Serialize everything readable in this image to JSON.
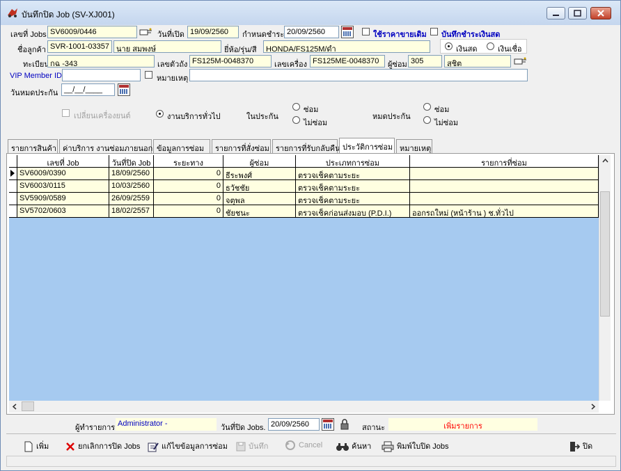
{
  "window": {
    "title": "บันทึกปิด Job (SV-XJ001)"
  },
  "header": {
    "job_no_label": "เลขที่ Jobs",
    "job_no": "SV6009/0446",
    "open_date_label": "วันที่เปิด",
    "open_date": "19/09/2560",
    "due_label": "กำหนดชำระ",
    "due_date": "20/09/2560",
    "use_old_price_label": "ใช้ราคาขายเดิม",
    "cash_record_label": "บันทึกชำระเงินสด",
    "customer_label": "ชื่อลูกค้า",
    "customer_code": "SVR-1001-03357",
    "customer_name": "นาย สมพงษ์",
    "model_label": "ยี่ห้อ/รุ่น/สี",
    "model": "HONDA/FS125M/ดำ",
    "cash_label": "เงินสด",
    "credit_label": "เงินเชื่อ",
    "plate_label": "ทะเบียน",
    "plate": "กฉ -343",
    "chassis_label": "เลขตัวถัง",
    "chassis": "FS125M-0048370",
    "engine_label": "เลขเครื่อง",
    "engine": "FS125ME-0048370",
    "mechanic_label": "ผู้ซ่อม",
    "mechanic_code": "305",
    "mechanic_name": "สุชิต",
    "vip_label": "VIP Member ID",
    "vip": "",
    "note_label": "หมายเหตุ",
    "note": "",
    "warranty_exp_label": "วันหมดประกัน",
    "warranty_exp": "__/__/____",
    "change_engine_label": "เปลี่ยนเครื่องยนต์",
    "general_service_label": "งานบริการทั่วไป",
    "in_warranty_label": "ในประกัน",
    "expired_label": "หมดประกัน",
    "repair_label": "ซ่อม",
    "no_repair_label": "ไม่ซ่อม"
  },
  "tabs": [
    "รายการสินค้า",
    "ค่าบริการ งานซ่อมภายนอก",
    "ข้อมูลการซ่อม",
    "รายการที่สั่งซ่อม",
    "รายการที่รับกลับคืน",
    "ประวัติการซ่อม",
    "หมายเหตุ"
  ],
  "grid": {
    "columns": [
      "เลขที่ Job",
      "วันที่ปิด Job",
      "ระยะทาง",
      "ผู้ซ่อม",
      "ประเภทการซ่อม",
      "รายการที่ซ่อม"
    ],
    "rows": [
      [
        "SV6009/0390",
        "18/09/2560",
        "0",
        "ธีระพงศ์",
        "ตรวจเช็คตามระยะ",
        ""
      ],
      [
        "SV6003/0115",
        "10/03/2560",
        "0",
        "ธวัชชัย",
        "ตรวจเช็คตามระยะ",
        ""
      ],
      [
        "SV5909/0589",
        "26/09/2559",
        "0",
        "จตุพล",
        "ตรวจเช็คตามระยะ",
        ""
      ],
      [
        "SV5702/0603",
        "18/02/2557",
        "0",
        "ชัยชนะ",
        "ตรวจเช็คก่อนส่งมอบ (P.D.I.)",
        "ออกรถใหม่ (หน้าร้าน ) ช.ทั่วไป"
      ]
    ]
  },
  "footer": {
    "operator_label": "ผู้ทำรายการ",
    "operator": "Administrator -",
    "close_date_label": "วันที่ปิด Jobs.",
    "close_date": "20/09/2560",
    "status_label": "สถานะ",
    "status": "เพิ่มรายการ",
    "status_color": "#ff0000"
  },
  "toolbar": {
    "add": "เพิ่ม",
    "cancel_close": "ยกเลิกการปิด Jobs",
    "edit_repair": "แก้ไขข้อมูลการซ่อม",
    "save": "บันทึก",
    "cancel": "Cancel",
    "search": "ค้นหา",
    "print": "พิมพ์ใบปิด Jobs",
    "close": "ปิด"
  }
}
